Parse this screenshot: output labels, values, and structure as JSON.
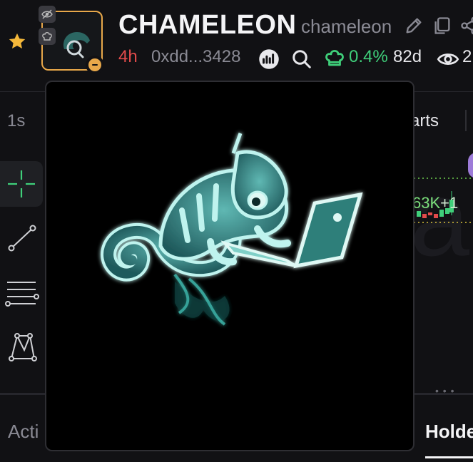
{
  "token": {
    "name": "CHAMELEON",
    "ticker": "chameleon",
    "age": "4h",
    "address": "0xdd...3428",
    "holders_change_pct": "0.4%",
    "days": "82d",
    "views": "2"
  },
  "chart": {
    "timeframe": "1s",
    "charts_tab_label": "arts",
    "price_label": "63K",
    "price_change": "+1"
  },
  "bottom_tabs": {
    "activity_label": "Acti",
    "holders_label": "Holde"
  },
  "colors": {
    "accent_orange": "#e8a84a",
    "positive_green": "#3fcf7a",
    "negative_red": "#e24b4b",
    "background": "#111114",
    "popup_bg": "#000000",
    "chameleon_glow": "#7fe8e0"
  },
  "icons": [
    "star-icon",
    "hide-icon",
    "chef-hat-icon",
    "pencil-icon",
    "copy-icon",
    "share-icon",
    "chart-icon",
    "search-icon",
    "chef-hat-icon",
    "eye-icon",
    "crosshair-icon",
    "trendline-icon",
    "horizontal-lines-icon",
    "pattern-icon"
  ]
}
